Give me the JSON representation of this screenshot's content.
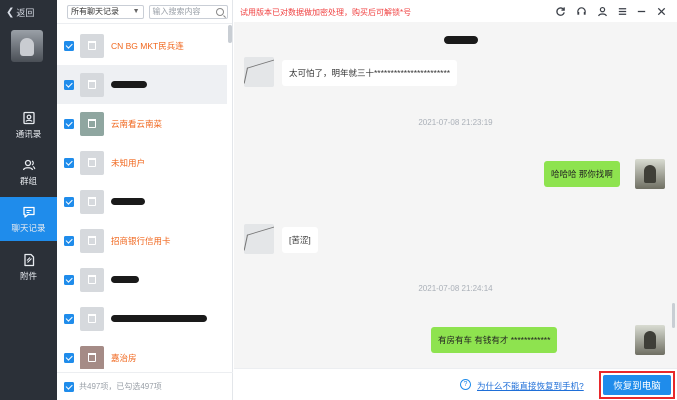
{
  "nav": {
    "back_label": "返回",
    "items": [
      {
        "label": "通讯录",
        "icon": "contacts-icon"
      },
      {
        "label": "群组",
        "icon": "group-icon"
      },
      {
        "label": "聊天记录",
        "icon": "chat-icon",
        "active": true
      },
      {
        "label": "附件",
        "icon": "attachment-icon"
      }
    ]
  },
  "list": {
    "filter_value": "所有聊天记录",
    "search_placeholder": "输入搜索内容",
    "contacts": [
      {
        "name": "CN BG MKT民兵连",
        "avatar": "grey"
      },
      {
        "name": "",
        "avatar": "grey"
      },
      {
        "name": "云南看云南菜",
        "avatar": "green"
      },
      {
        "name": "未知用户",
        "avatar": "grey"
      },
      {
        "name": "",
        "avatar": "grey"
      },
      {
        "name": "招商银行信用卡",
        "avatar": "grey"
      },
      {
        "name": "",
        "avatar": "grey"
      },
      {
        "name": "",
        "avatar": "grey"
      },
      {
        "name": "嘉治房",
        "avatar": "brown"
      }
    ],
    "footer_text": "共497项，已勾选497项"
  },
  "chat": {
    "trial_notice": "试用版本已对数据做加密处理，购买后可解锁*号",
    "messages": [
      {
        "direction": "in",
        "text": "太可怕了，明年就三十***********************"
      },
      {
        "type": "time",
        "text": "2021-07-08 21:23:19"
      },
      {
        "direction": "out",
        "text": "哈哈哈 那你找啊"
      },
      {
        "direction": "in",
        "text": "[苦涩]"
      },
      {
        "type": "time",
        "text": "2021-07-08 21:24:14"
      },
      {
        "direction": "out",
        "text": "有房有车 有钱有才 ************"
      }
    ],
    "help_link": "为什么不能直接恢复到手机?",
    "restore_button": "恢复到电脑"
  },
  "colors": {
    "accent": "#1f8ceb",
    "nav_bg": "#2b3038",
    "outgoing_bubble": "#8ee34f",
    "warning": "#f04040",
    "contact_name": "#f0661c"
  }
}
